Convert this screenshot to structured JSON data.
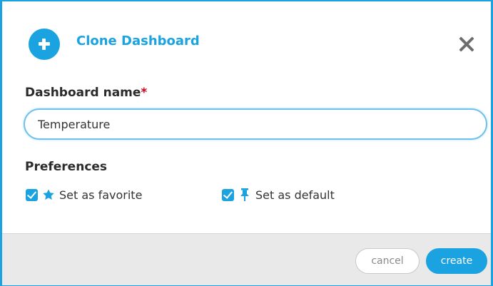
{
  "dialog": {
    "title": "Clone Dashboard",
    "header_icon": "plus-circle-icon",
    "close_icon": "close-icon"
  },
  "form": {
    "name_label": "Dashboard name",
    "required_marker": "*",
    "name_value": "Temperature",
    "preferences_label": "Preferences",
    "preferences": [
      {
        "label": "Set as favorite",
        "icon": "star-icon",
        "checked": true
      },
      {
        "label": "Set as default",
        "icon": "pin-icon",
        "checked": true
      }
    ]
  },
  "footer": {
    "cancel_label": "cancel",
    "create_label": "create"
  },
  "colors": {
    "accent": "#1aa3e0",
    "required": "#d0021b",
    "footer_bg": "#e9e9e9"
  }
}
